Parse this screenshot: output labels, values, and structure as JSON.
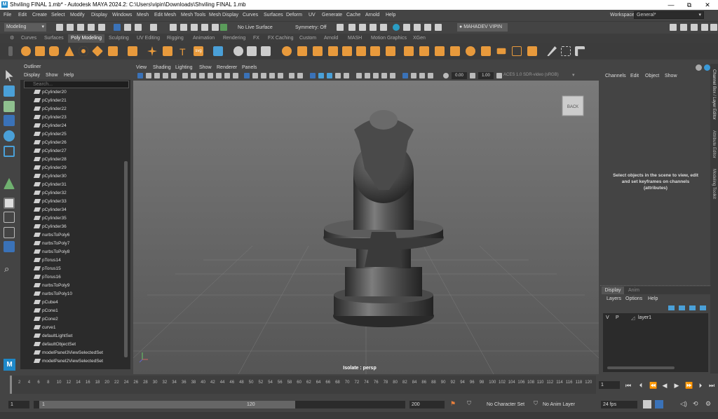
{
  "window": {
    "title": "Shviling FINAL 1.mb* - Autodesk MAYA 2024.2: C:\\Users\\vipin\\Downloads\\Shviling FINAL 1.mb",
    "minimize": "—",
    "restore": "⧉",
    "close": "✕"
  },
  "menu": [
    "File",
    "Edit",
    "Create",
    "Select",
    "Modify",
    "Display",
    "Windows",
    "Mesh",
    "Edit Mesh",
    "Mesh Tools",
    "Mesh Display",
    "Curves",
    "Surfaces",
    "Deform",
    "UV",
    "Generate",
    "Cache",
    "Arnold",
    "Help"
  ],
  "workspace": {
    "label": "Workspace:",
    "value": "General*"
  },
  "statusline": {
    "mode": "Modeling",
    "live_surface": "No Live Surface",
    "symmetry": "Symmetry: Off",
    "user": "MAHADEV VIPIN"
  },
  "shelf_tabs": [
    "Curves",
    "Surfaces",
    "Poly Modeling",
    "Sculpting",
    "UV Editing",
    "Rigging",
    "Animation",
    "Rendering",
    "FX",
    "FX Caching",
    "Custom",
    "Arnold",
    "MASH",
    "Motion Graphics",
    "XGen"
  ],
  "active_shelf": "Poly Modeling",
  "outliner": {
    "title": "Outliner",
    "menu": [
      "Display",
      "Show",
      "Help"
    ],
    "search_placeholder": "Search...",
    "items": [
      "pCylinder20",
      "pCylinder21",
      "pCylinder22",
      "pCylinder23",
      "pCylinder24",
      "pCylinder25",
      "pCylinder26",
      "pCylinder27",
      "pCylinder28",
      "pCylinder29",
      "pCylinder30",
      "pCylinder31",
      "pCylinder32",
      "pCylinder33",
      "pCylinder34",
      "pCylinder35",
      "pCylinder36",
      "nurbsToPoly6",
      "nurbsToPoly7",
      "nurbsToPoly8",
      "pTorus14",
      "pTorus15",
      "pTorus16",
      "nurbsToPoly9",
      "nurbsToPoly10",
      "pCube4",
      "pCone1",
      "pCone2",
      "curve1",
      "defaultLightSet",
      "defaultObjectSet",
      "modelPanel3ViewSelectedSet",
      "modelPanel2ViewSelectedSet"
    ]
  },
  "viewport": {
    "menu": [
      "View",
      "Shading",
      "Lighting",
      "Show",
      "Renderer",
      "Panels"
    ],
    "field1": "0.00",
    "field2": "1.00",
    "colorspace": "ACES 1.0 SDR-video (sRGB)",
    "back_label": "BACK",
    "camera_label": "Isolate : persp"
  },
  "channel_box": {
    "menu": [
      "Channels",
      "Edit",
      "Object",
      "Show"
    ],
    "empty_message": "Select objects in the scene to view, edit and set keyframes on channels (attributes)",
    "side_tabs": [
      "Channel Box / Layer Editor",
      "Attribute Editor",
      "Modeling Toolkit"
    ]
  },
  "layer_editor": {
    "tabs": [
      "Display",
      "Anim"
    ],
    "menu": [
      "Layers",
      "Options",
      "Help"
    ],
    "layer": {
      "v": "V",
      "p": "P",
      "name": "layer1"
    }
  },
  "timeline": {
    "ticks": [
      2,
      4,
      6,
      8,
      10,
      12,
      14,
      16,
      18,
      20,
      22,
      24,
      26,
      28,
      30,
      32,
      34,
      36,
      38,
      40,
      42,
      44,
      46,
      48,
      50,
      52,
      54,
      56,
      58,
      60,
      62,
      64,
      66,
      68,
      70,
      72,
      74,
      76,
      78,
      80,
      82,
      84,
      86,
      88,
      90,
      92,
      94,
      96,
      98,
      100,
      102,
      104,
      106,
      108,
      110,
      112,
      114,
      116,
      118,
      120
    ],
    "current_frame": "1"
  },
  "range": {
    "start": "1",
    "range_start": "1",
    "range_end": "120",
    "end": "200",
    "character_set": "No Character Set",
    "anim_layer": "No Anim Layer",
    "fps": "24 fps"
  }
}
